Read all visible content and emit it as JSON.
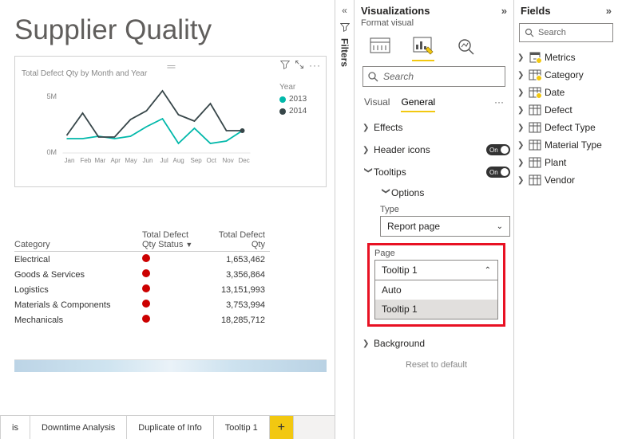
{
  "report": {
    "title": "Supplier Quality"
  },
  "chart": {
    "title": "Total Defect Qty by Month and Year",
    "legend_title": "Year",
    "y_ticks": [
      "5M",
      "0M"
    ],
    "x_ticks": [
      "Jan",
      "Feb",
      "Mar",
      "Apr",
      "May",
      "Jun",
      "Jul",
      "Aug",
      "Sep",
      "Oct",
      "Nov",
      "Dec"
    ],
    "series": [
      {
        "name": "2013",
        "color": "#01b8aa"
      },
      {
        "name": "2014",
        "color": "#374649"
      }
    ]
  },
  "chart_data": {
    "type": "line",
    "title": "Total Defect Qty by Month and Year",
    "xlabel": "",
    "ylabel": "",
    "ylim": [
      0,
      6000000
    ],
    "categories": [
      "Jan",
      "Feb",
      "Mar",
      "Apr",
      "May",
      "Jun",
      "Jul",
      "Aug",
      "Sep",
      "Oct",
      "Nov",
      "Dec"
    ],
    "series": [
      {
        "name": "2013",
        "color": "#01b8aa",
        "values": [
          1300000,
          1300000,
          1500000,
          1300000,
          1500000,
          2300000,
          3000000,
          900000,
          2200000,
          900000,
          1100000,
          2000000
        ]
      },
      {
        "name": "2014",
        "color": "#374649",
        "values": [
          1600000,
          3600000,
          1400000,
          1400000,
          3000000,
          3800000,
          5600000,
          3500000,
          2900000,
          4500000,
          2000000,
          2000000
        ]
      }
    ]
  },
  "table": {
    "columns": [
      "Category",
      "Total Defect Qty Status",
      "Total Defect Qty"
    ],
    "col_sort_arrow": "▼",
    "rows": [
      {
        "category": "Electrical",
        "qty": "1,653,462"
      },
      {
        "category": "Goods & Services",
        "qty": "3,356,864"
      },
      {
        "category": "Logistics",
        "qty": "13,151,993"
      },
      {
        "category": "Materials & Components",
        "qty": "3,753,994"
      },
      {
        "category": "Mechanicals",
        "qty": "18,285,712"
      }
    ]
  },
  "tabs": {
    "items": [
      "is",
      "Downtime Analysis",
      "Duplicate of Info",
      "Tooltip 1"
    ],
    "add": "+"
  },
  "filters_tab": {
    "label": "Filters"
  },
  "vis_pane": {
    "title": "Visualizations",
    "subtitle": "Format visual",
    "search_placeholder": "Search",
    "subtabs": {
      "visual": "Visual",
      "general": "General"
    },
    "rows": {
      "effects": "Effects",
      "header_icons": "Header icons",
      "tooltips": "Tooltips",
      "options": "Options",
      "background": "Background"
    },
    "toggle_on": "On",
    "type_label": "Type",
    "type_value": "Report page",
    "page_label": "Page",
    "page_value": "Tooltip 1",
    "page_options": [
      "Auto",
      "Tooltip 1"
    ],
    "reset": "Reset to default"
  },
  "fields_pane": {
    "title": "Fields",
    "search_placeholder": "Search",
    "tables": [
      "Metrics",
      "Category",
      "Date",
      "Defect",
      "Defect Type",
      "Material Type",
      "Plant",
      "Vendor"
    ]
  }
}
